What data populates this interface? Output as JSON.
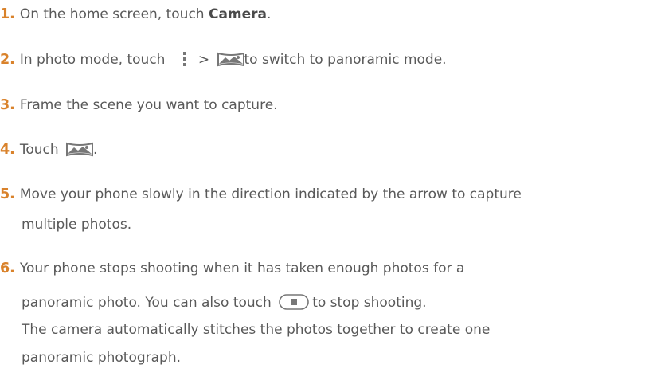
{
  "steps": [
    {
      "num": "1.",
      "pre": "On the home screen, touch ",
      "bold": "Camera",
      "post": "."
    },
    {
      "num": "2.",
      "pre": "In photo mode, touch",
      "sep": ">",
      "post": "to switch to panoramic mode."
    },
    {
      "num": "3.",
      "text": "Frame the scene you want to capture."
    },
    {
      "num": "4.",
      "pre": "Touch",
      "post": "."
    },
    {
      "num": "5.",
      "line1": "Move your phone slowly in the direction indicated by the arrow to capture",
      "line2": "multiple photos."
    },
    {
      "num": "6.",
      "line1": "Your phone stops shooting when it has taken enough photos for a",
      "line2_pre": "panoramic photo. You can also touch",
      "line2_post": "to stop shooting.",
      "line3": "The camera automatically stitches the photos together to create one",
      "line4": "panoramic photograph."
    }
  ],
  "colors": {
    "number": "#d9822b",
    "text": "#595959",
    "icon": "#777777"
  },
  "icons": [
    "more-menu-icon",
    "panorama-icon",
    "panorama-shutter-icon",
    "stop-button-icon"
  ]
}
